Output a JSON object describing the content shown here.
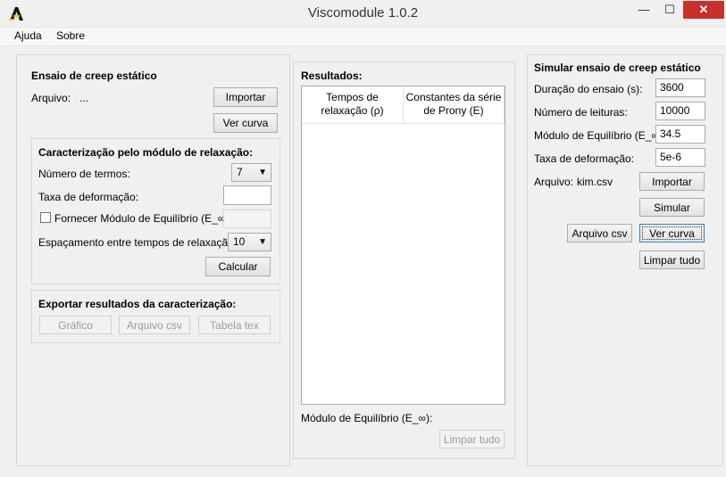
{
  "window": {
    "title": "Viscomodule 1.0.2",
    "minimize": "—",
    "maximize": "☐",
    "close": "✕"
  },
  "menu": {
    "items": [
      "Ajuda",
      "Sobre"
    ]
  },
  "left": {
    "creep_title": "Ensaio de creep estático",
    "arquivo_label": "Arquivo:",
    "arquivo_value": "...",
    "importar": "Importar",
    "ver_curva": "Ver curva",
    "caracterizacao": {
      "title": "Caracterização pelo módulo de relaxação:",
      "num_termos_label": "Número de termos:",
      "num_termos_value": "7",
      "taxa_label": "Taxa de deformação:",
      "taxa_value": "",
      "fornecer_label": "Fornecer Módulo de Equilíbrio (E_∞):",
      "espacamento_label": "Espaçamento entre tempos de relaxação:",
      "espacamento_value": "10",
      "calcular": "Calcular"
    },
    "exportar": {
      "title": "Exportar resultados da caracterização:",
      "grafico": "Gráfico",
      "arquivo_csv": "Arquivo csv",
      "tabela_tex": "Tabela tex"
    }
  },
  "middle": {
    "title": "Resultados:",
    "col1": "Tempos de relaxação (ρ)",
    "col2": "Constantes da série de Prony (E)",
    "modulo_label": "Módulo de Equilíbrio (E_∞):",
    "limpar": "Limpar tudo"
  },
  "right": {
    "title": "Simular ensaio de creep estático",
    "duracao_label": "Duração do ensaio (s):",
    "duracao_value": "3600",
    "leituras_label": "Número de leituras:",
    "leituras_value": "10000",
    "modulo_label": "Módulo de Equilíbrio (E_∞):",
    "modulo_value": "34.5",
    "taxa_label": "Taxa de deformação:",
    "taxa_value": "5e-6",
    "arquivo_label": "Arquivo:",
    "arquivo_value": "kim.csv",
    "importar": "Importar",
    "simular": "Simular",
    "arquivo_csv": "Arquivo csv",
    "ver_curva": "Ver curva",
    "limpar": "Limpar tudo"
  }
}
